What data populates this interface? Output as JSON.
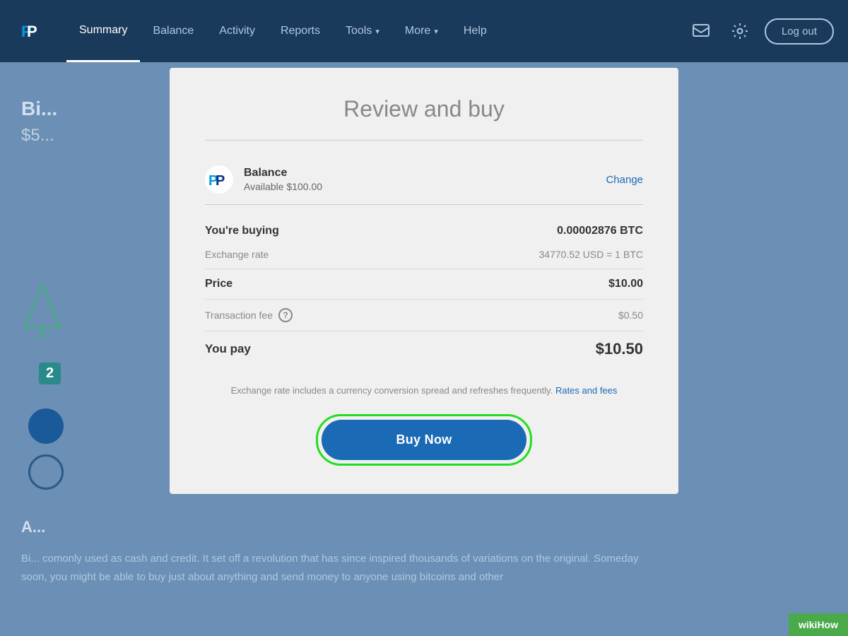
{
  "navbar": {
    "logo_alt": "PayPal",
    "links": [
      {
        "id": "summary",
        "label": "Summary",
        "active": true,
        "has_chevron": false
      },
      {
        "id": "balance",
        "label": "Balance",
        "active": false,
        "has_chevron": false
      },
      {
        "id": "activity",
        "label": "Activity",
        "active": false,
        "has_chevron": false
      },
      {
        "id": "reports",
        "label": "Reports",
        "active": false,
        "has_chevron": false
      },
      {
        "id": "tools",
        "label": "Tools",
        "active": false,
        "has_chevron": true
      },
      {
        "id": "more",
        "label": "More",
        "active": false,
        "has_chevron": true
      },
      {
        "id": "help",
        "label": "Help",
        "active": false,
        "has_chevron": false
      }
    ],
    "logout_label": "Log out"
  },
  "background": {
    "title": "Bi...",
    "price": "$5...",
    "badge_number": "2",
    "article_title": "A...",
    "article_text": "Bi... comonly used as cash and credit. It set off a revolution that has since inspired thousands of variations on the original. Someday soon, you might be able to buy just about anything and send money to anyone using bitcoins and other"
  },
  "modal": {
    "title": "Review and buy",
    "payment_method": {
      "logo_alt": "PayPal",
      "label": "Balance",
      "available": "Available $100.00",
      "change_label": "Change"
    },
    "buying_label": "You're buying",
    "buying_value": "0.00002876 BTC",
    "exchange_rate_label": "Exchange rate",
    "exchange_rate_value": "34770.52 USD = 1 BTC",
    "price_label": "Price",
    "price_value": "$10.00",
    "transaction_fee_label": "Transaction fee",
    "transaction_fee_value": "$0.50",
    "you_pay_label": "You pay",
    "you_pay_value": "$10.50",
    "disclaimer_text": "Exchange rate includes a currency conversion spread and refreshes frequently.",
    "rates_link": "Rates and fees",
    "buy_now_label": "Buy Now"
  },
  "wikihow": {
    "label": "wikiHow"
  }
}
